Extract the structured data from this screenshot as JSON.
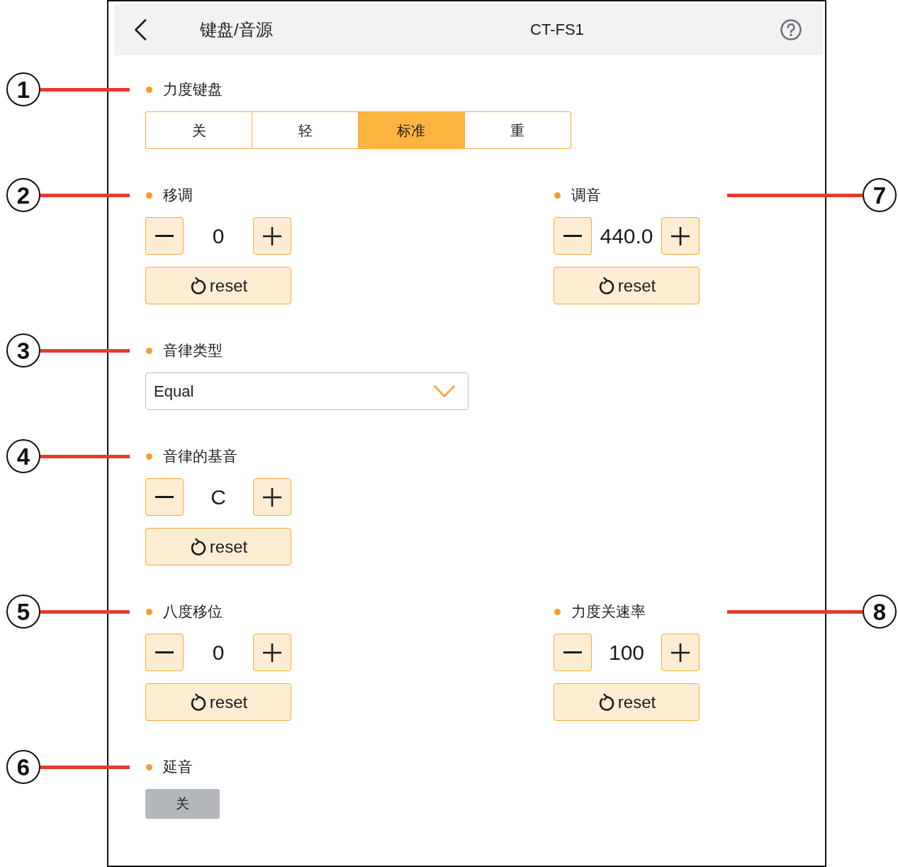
{
  "header": {
    "title": "键盘/音源",
    "device": "CT-FS1"
  },
  "rows": [
    {
      "items": [
        {
          "kind": "segmented",
          "callout": "1",
          "label": "力度键盘",
          "options": [
            {
              "label": "关",
              "selected": false
            },
            {
              "label": "轻",
              "selected": false
            },
            {
              "label": "标准",
              "selected": true
            },
            {
              "label": "重",
              "selected": false
            }
          ]
        }
      ]
    },
    {
      "items": [
        {
          "kind": "stepper",
          "callout": "2",
          "label": "移调",
          "value": "0",
          "reset": "reset"
        },
        {
          "kind": "stepper",
          "callout": "7",
          "label": "调音",
          "value": "440.0",
          "reset": "reset"
        }
      ]
    },
    {
      "items": [
        {
          "kind": "dropdown",
          "callout": "3",
          "label": "音律类型",
          "value": "Equal"
        }
      ]
    },
    {
      "items": [
        {
          "kind": "stepper",
          "callout": "4",
          "label": "音律的基音",
          "value": "C",
          "reset": "reset"
        }
      ]
    },
    {
      "items": [
        {
          "kind": "stepper",
          "callout": "5",
          "label": "八度移位",
          "value": "0",
          "reset": "reset"
        },
        {
          "kind": "stepper",
          "callout": "8",
          "label": "力度关速率",
          "value": "100",
          "reset": "reset"
        }
      ]
    },
    {
      "items": [
        {
          "kind": "toggle",
          "callout": "6",
          "label": "延音",
          "toggle": {
            "text": "关",
            "on": false
          }
        }
      ]
    }
  ]
}
